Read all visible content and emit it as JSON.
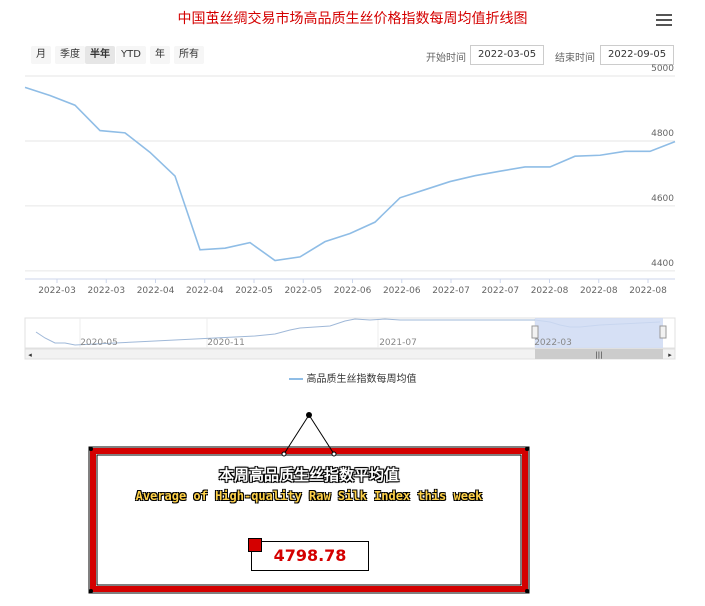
{
  "title": "中国茧丝绸交易市场高品质生丝价格指数每周均值折线图",
  "range_buttons": [
    "月",
    "季度",
    "半年",
    "YTD",
    "年",
    "所有"
  ],
  "active_range": "半年",
  "start_label": "开始时间",
  "start_date": "2022-03-05",
  "end_label": "结束时间",
  "end_date": "2022-09-05",
  "legend": "高品质生丝指数每周均值",
  "colors": {
    "title": "#d40000",
    "series": "#8fbde6",
    "navigator_fill": "#cfdaf3",
    "panel_red": "#d40000"
  },
  "navigator": {
    "labels": [
      "2020-05",
      "2020-11",
      "2021-07",
      "2022-03"
    ]
  },
  "panel": {
    "title_cn": "本周高品质生丝指数平均值",
    "title_en": "Average of High-quality Raw Silk Index this week",
    "value": "4798.78"
  },
  "chart_data": {
    "type": "line",
    "title": "中国茧丝绸交易市场高品质生丝价格指数每周均值折线图",
    "x_tick_labels": [
      "2022-03",
      "2022-03",
      "2022-04",
      "2022-04",
      "2022-05",
      "2022-05",
      "2022-06",
      "2022-06",
      "2022-07",
      "2022-07",
      "2022-08",
      "2022-08",
      "2022-08"
    ],
    "y_ticks": [
      4400,
      4600,
      4800,
      5000
    ],
    "ylim": [
      4375,
      5000
    ],
    "grid": true,
    "legend_position": "bottom",
    "series": [
      {
        "name": "高品质生丝指数每周均值",
        "values": [
          4965,
          4940,
          4910,
          4832,
          4825,
          4765,
          4692,
          4465,
          4470,
          4487,
          4432,
          4443,
          4490,
          4515,
          4550,
          4625,
          4650,
          4675,
          4693,
          4707,
          4720,
          4720,
          4753,
          4756,
          4768,
          4768,
          4798
        ]
      }
    ]
  }
}
